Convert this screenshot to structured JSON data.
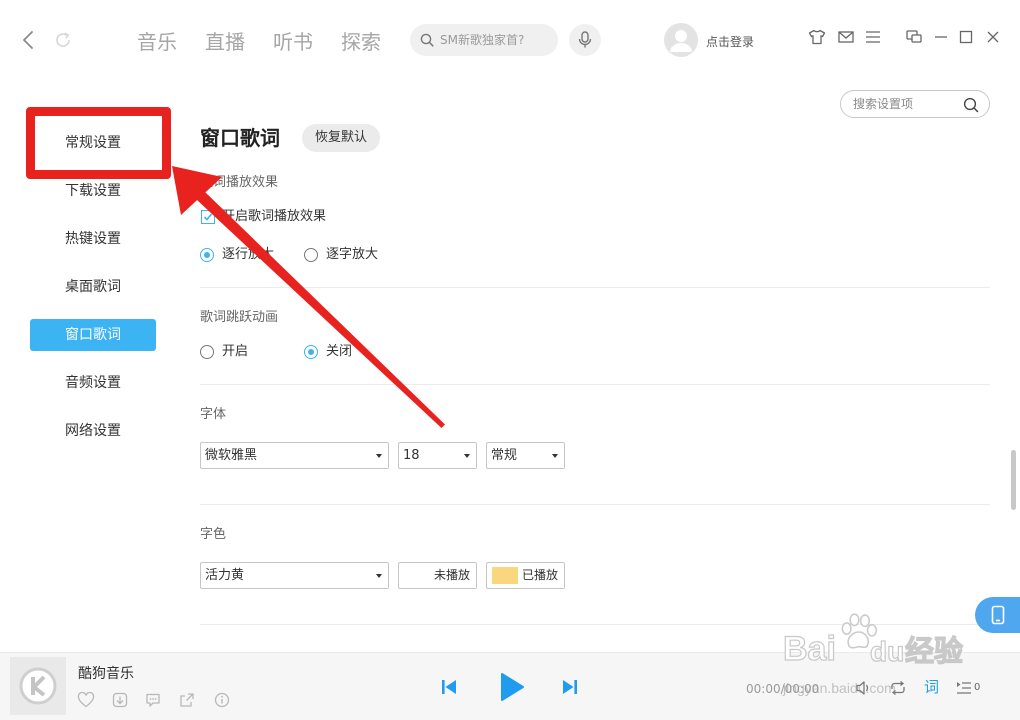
{
  "theme": {
    "accent": "#3cb4f4",
    "player_blue": "#1f9cf0",
    "annotation_red": "#e8231f"
  },
  "topbar": {
    "nav_tabs": [
      {
        "label": "音乐"
      },
      {
        "label": "直播"
      },
      {
        "label": "听书"
      },
      {
        "label": "探索"
      }
    ],
    "search_placeholder": "SM新歌独家首?",
    "login_label": "点击登录",
    "icons": [
      "back-icon",
      "refresh-icon",
      "search-icon",
      "mic-icon",
      "avatar-icon",
      "skin-icon",
      "mail-icon",
      "menu-icon",
      "mini-mode-icon",
      "minimize-icon",
      "maximize-icon",
      "close-icon"
    ]
  },
  "sidebar": {
    "items": [
      {
        "label": "常规设置",
        "active": false
      },
      {
        "label": "下载设置",
        "active": false
      },
      {
        "label": "热键设置",
        "active": false
      },
      {
        "label": "桌面歌词",
        "active": false
      },
      {
        "label": "窗口歌词",
        "active": true
      },
      {
        "label": "音频设置",
        "active": false
      },
      {
        "label": "网络设置",
        "active": false
      }
    ]
  },
  "main": {
    "title": "窗口歌词",
    "reset_label": "恢复默认",
    "settings_search_placeholder": "搜索设置项",
    "play_effect": {
      "label": "歌词播放效果",
      "enable": {
        "label": "开启歌词播放效果",
        "checked": true
      },
      "modes": [
        {
          "label": "逐行放大",
          "selected": true
        },
        {
          "label": "逐字放大",
          "selected": false
        }
      ]
    },
    "jump_animation": {
      "label": "歌词跳跃动画",
      "options": [
        {
          "label": "开启",
          "selected": false
        },
        {
          "label": "关闭",
          "selected": true
        }
      ]
    },
    "font": {
      "label": "字体",
      "typeface": "微软雅黑",
      "size": "18",
      "style": "常规"
    },
    "color": {
      "label": "字色",
      "scheme": "活力黄",
      "unplayed": {
        "label": "未播放",
        "swatch": "#ffffff"
      },
      "played": {
        "label": "已播放",
        "swatch": "#f9d77e"
      }
    }
  },
  "player": {
    "title": "酷狗音乐",
    "time": "00:00/00:00",
    "lyrics_label": "词",
    "playlist_count": "0",
    "icons": [
      "kugou-logo-icon",
      "heart-icon",
      "download-icon",
      "comment-icon",
      "share-icon",
      "info-icon",
      "prev-icon",
      "play-icon",
      "next-icon",
      "volume-icon",
      "loop-icon",
      "playlist-icon",
      "phone-icon"
    ]
  },
  "watermark": {
    "brand_left": "Bai",
    "brand_right": "du",
    "brand_cn": "经验",
    "url": "jingyan.baidu.com"
  }
}
